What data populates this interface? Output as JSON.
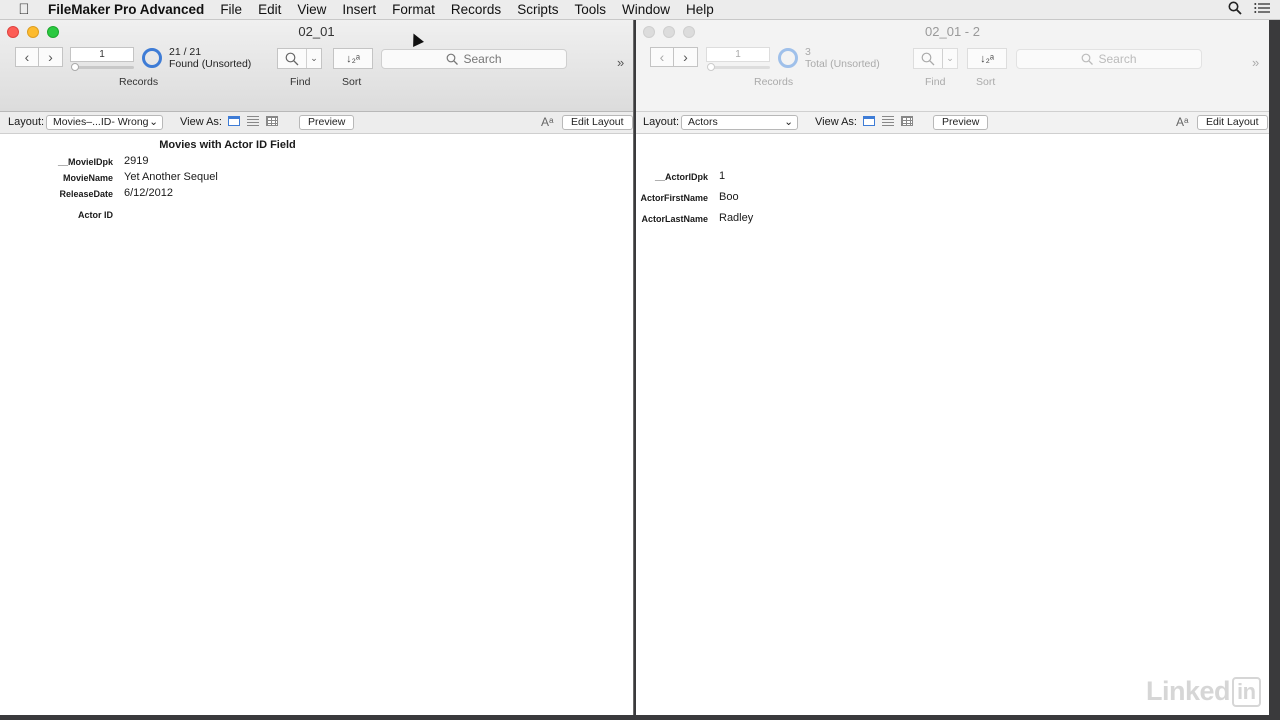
{
  "menubar": {
    "app": "FileMaker Pro Advanced",
    "items": [
      "File",
      "Edit",
      "View",
      "Insert",
      "Format",
      "Records",
      "Scripts",
      "Tools",
      "Window",
      "Help"
    ]
  },
  "left_window": {
    "title": "02_01",
    "record_number": "1",
    "count": "21 / 21",
    "found_status": "Found (Unsorted)",
    "records_label": "Records",
    "find_label": "Find",
    "sort_label": "Sort",
    "search_placeholder": "Search",
    "layout_label": "Layout:",
    "layout_value": "Movies–...ID- Wrong",
    "view_as_label": "View As:",
    "preview_label": "Preview",
    "edit_layout_label": "Edit Layout",
    "layout_title": "Movies with Actor ID Field",
    "fields": [
      {
        "label": "__MovieIDpk",
        "value": "2919"
      },
      {
        "label": "MovieName",
        "value": "Yet Another Sequel"
      },
      {
        "label": "ReleaseDate",
        "value": "6/12/2012"
      },
      {
        "label": "Actor ID",
        "value": ""
      }
    ]
  },
  "right_window": {
    "title": "02_01 - 2",
    "record_number": "1",
    "count": "3",
    "found_status": "Total (Unsorted)",
    "records_label": "Records",
    "find_label": "Find",
    "sort_label": "Sort",
    "search_placeholder": "Search",
    "layout_label": "Layout:",
    "layout_value": "Actors",
    "view_as_label": "View As:",
    "preview_label": "Preview",
    "edit_layout_label": "Edit Layout",
    "fields": [
      {
        "label": "__ActorIDpk",
        "value": "1"
      },
      {
        "label": "ActorFirstName",
        "value": "Boo"
      },
      {
        "label": "ActorLastName",
        "value": "Radley"
      }
    ]
  },
  "watermark": {
    "text": "Linked",
    "suffix": "in"
  }
}
